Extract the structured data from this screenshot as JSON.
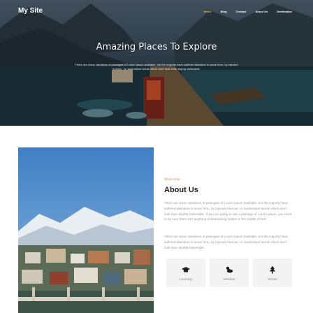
{
  "header": {
    "logo": "My Site",
    "nav": [
      {
        "label": "Home",
        "active": true
      },
      {
        "label": "Blog"
      },
      {
        "label": "Contact"
      },
      {
        "label": "About Us"
      },
      {
        "label": "Destination"
      }
    ],
    "accent_color": "#f5a623"
  },
  "hero": {
    "title": "Amazing Places To Explore",
    "text": "There are many variations of passages of Lorem Ipsum available, but the majority have suffered alteration in some form, by injected humour, or randomised words which don't look even slightly believable."
  },
  "about": {
    "welcome": "Welcome",
    "title": "About Us",
    "paragraph1": "There are many variations of passages of Lorem Ipsum available, but the majority have suffered alteration in some form, by injected humour, or randomised words which don't look even slightly believable. If you are going to use a passage of Lorem Ipsum, you need to be sure there isn't anything embarrassing hidden in the middle of text.",
    "paragraph2": "There are many variations of passages of Lorem Ipsum available, but the majority have suffered alteration in some form, by injected humour, or randomised words which don't look even slightly believable.",
    "welcome_color": "#f07d2a",
    "features": [
      {
        "icon": "graduation-cap-icon",
        "label": "Learning"
      },
      {
        "icon": "cloud-sun-icon",
        "label": "Weather"
      },
      {
        "icon": "tree-icon",
        "label": "Terrain"
      }
    ]
  }
}
